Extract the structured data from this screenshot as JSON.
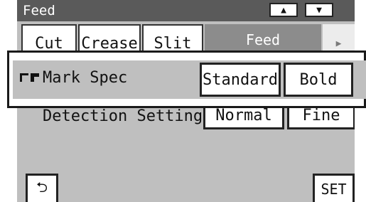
{
  "window": {
    "title": "Feed"
  },
  "header": {
    "scroll_up_glyph": "▲",
    "scroll_down_glyph": "▼"
  },
  "tabs": [
    {
      "label": "Cut",
      "active": false
    },
    {
      "label": "Crease",
      "active": false
    },
    {
      "label": "Slit",
      "active": false
    },
    {
      "label": "Feed",
      "active": true
    }
  ],
  "tab_more_glyph": "▶",
  "settings": {
    "mark_spec": {
      "label": "Mark Spec",
      "options": [
        "Standard",
        "Bold"
      ],
      "icons": [
        "thin-corner-mark-icon",
        "bold-corner-mark-icon"
      ]
    },
    "detection": {
      "label": "Detection Setting",
      "options": [
        "Normal",
        "Fine"
      ]
    }
  },
  "footer": {
    "back_glyph": "⮌",
    "set_label": "SET"
  },
  "colors": {
    "panel": "#bfbfbf",
    "titlebar": "#5a5a5a",
    "active_tab": "#8c8c8c",
    "button": "#ffffff"
  }
}
